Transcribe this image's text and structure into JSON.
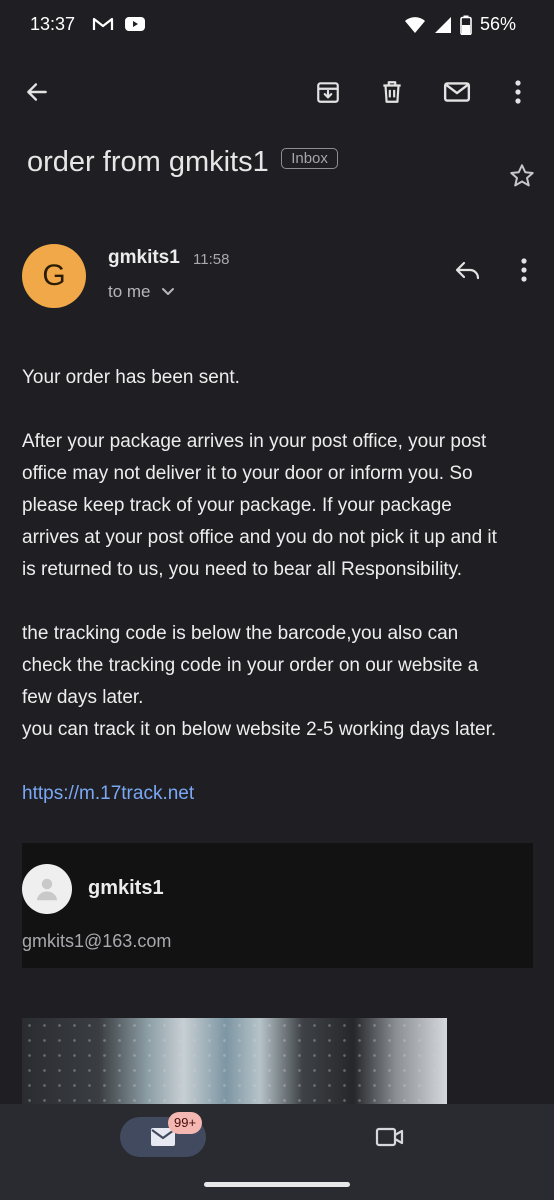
{
  "status_bar": {
    "time": "13:37",
    "battery": "56%",
    "icons": [
      "gmail-icon",
      "youtube-icon",
      "wifi-icon",
      "signal-icon",
      "battery-icon"
    ]
  },
  "app_bar": {
    "actions": [
      "back-icon",
      "archive-icon",
      "delete-icon",
      "mark-unread-icon",
      "more-icon"
    ]
  },
  "email": {
    "subject": "order from gmkits1",
    "label": "Inbox",
    "sender": {
      "initial": "G",
      "name": "gmkits1",
      "time": "11:58",
      "recipient": "to me",
      "avatar_color": "#f0a848"
    },
    "body": {
      "p1": "Your order has been sent.",
      "p2_lines": [
        "After your package arrives in your post office, your post",
        "office may not deliver it to your door or inform you. So",
        "please keep track of your package. If your package",
        "arrives at your post office and you do not pick it up and it",
        "is returned to us, you need to bear all Responsibility."
      ],
      "p3_lines": [
        "the tracking code is below the barcode,you also can",
        "check the tracking code in your order on our website a",
        "few days later.",
        "you can track it on below website 2-5 working days later."
      ],
      "link": "https://m.17track.net"
    },
    "signature": {
      "name": "gmkits1",
      "email": "gmkits1@163.com"
    }
  },
  "bottom_nav": {
    "mail_badge": "99+",
    "items": [
      "mail-icon",
      "meet-icon"
    ],
    "active_color": "#414a5e"
  }
}
